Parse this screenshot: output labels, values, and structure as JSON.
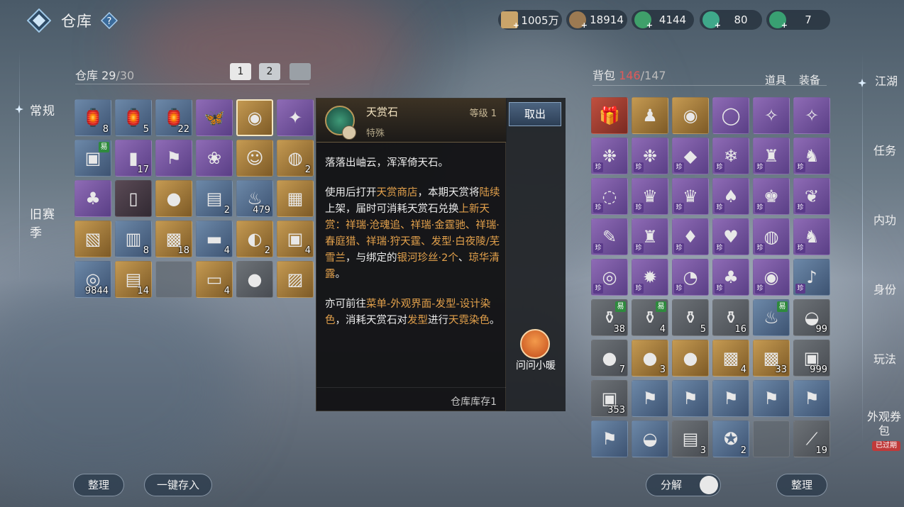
{
  "header": {
    "title": "仓库",
    "help_label": "?"
  },
  "currencies": [
    {
      "icon": "scroll-coin-icon",
      "value": "1005万",
      "color": "#c9a46a"
    },
    {
      "icon": "copper-coin-icon",
      "value": "18914",
      "color": "#9c7a52"
    },
    {
      "icon": "jade-coin-icon",
      "value": "4144",
      "color": "#3fa06a"
    },
    {
      "icon": "jade-orb-icon",
      "value": "80",
      "color": "#3fa88a"
    },
    {
      "icon": "jade-token-icon",
      "value": "7",
      "color": "#39a072"
    }
  ],
  "left_nav": {
    "items": [
      {
        "label": "常规",
        "active": true
      },
      {
        "label": "旧赛季",
        "active": false
      }
    ]
  },
  "warehouse": {
    "label": "仓库",
    "count": "29",
    "capacity": "/30",
    "tabs": [
      "1",
      "2",
      ""
    ],
    "items": [
      {
        "q": "blue",
        "g": "🏮",
        "c": "8"
      },
      {
        "q": "blue",
        "g": "🏮",
        "c": "5"
      },
      {
        "q": "blue",
        "g": "🏮",
        "c": "22"
      },
      {
        "q": "purple",
        "g": "🦋",
        "c": ""
      },
      {
        "q": "gold",
        "g": "◉",
        "c": "",
        "sel": true
      },
      {
        "q": "purple",
        "g": "✦",
        "c": ""
      },
      {
        "q": "blue",
        "g": "▣",
        "c": "",
        "trade": "易"
      },
      {
        "q": "purple",
        "g": "▮",
        "c": "17"
      },
      {
        "q": "purple",
        "g": "⚑",
        "c": ""
      },
      {
        "q": "purple",
        "g": "❀",
        "c": ""
      },
      {
        "q": "gold",
        "g": "☺",
        "c": ""
      },
      {
        "q": "gold",
        "g": "◍",
        "c": "2"
      },
      {
        "q": "purple",
        "g": "♣",
        "c": ""
      },
      {
        "q": "dark",
        "g": "▯",
        "c": ""
      },
      {
        "q": "gold",
        "g": "●",
        "c": ""
      },
      {
        "q": "blue",
        "g": "▤",
        "c": "2"
      },
      {
        "q": "blue",
        "g": "♨",
        "c": "479"
      },
      {
        "q": "gold",
        "g": "▦",
        "c": ""
      },
      {
        "q": "gold",
        "g": "▧",
        "c": ""
      },
      {
        "q": "blue",
        "g": "▥",
        "c": "8"
      },
      {
        "q": "gold",
        "g": "▩",
        "c": "18"
      },
      {
        "q": "blue",
        "g": "▬",
        "c": "4"
      },
      {
        "q": "gold",
        "g": "◐",
        "c": "2"
      },
      {
        "q": "gold",
        "g": "▣",
        "c": "4"
      },
      {
        "q": "blue",
        "g": "◎",
        "c": "9844"
      },
      {
        "q": "gold",
        "g": "▤",
        "c": "14"
      },
      {
        "q": "empty",
        "g": "",
        "c": ""
      },
      {
        "q": "gold",
        "g": "▭",
        "c": "4"
      },
      {
        "q": "gray",
        "g": "●",
        "c": ""
      },
      {
        "q": "gold",
        "g": "▨",
        "c": ""
      }
    ]
  },
  "tooltip": {
    "name": "天赏石",
    "level": "等级 1",
    "type": "特殊",
    "para1": "落落出岫云，浑浑倚天石。",
    "p2": [
      {
        "t": "使用后打开"
      },
      {
        "t": "天赏商店",
        "h": true
      },
      {
        "t": "，本期天赏将"
      },
      {
        "t": "陆续",
        "h": true
      },
      {
        "t": "上架，届时可消耗天赏石兑换"
      },
      {
        "t": "上新天赏：祥瑞·沧魂追、祥瑞·金霆驰、祥瑞·春庭猎、祥瑞·狩天霆、发型·白夜陵/芜雪兰",
        "h": true
      },
      {
        "t": "，与绑定的"
      },
      {
        "t": "银河珍丝·2个",
        "h": true
      },
      {
        "t": "、"
      },
      {
        "t": "琼华清露",
        "h": true
      },
      {
        "t": "。"
      }
    ],
    "p3": [
      {
        "t": "亦可前往"
      },
      {
        "t": "菜单-外观界面-发型-设计染色",
        "h": true
      },
      {
        "t": "，消耗天赏石对"
      },
      {
        "t": "发型",
        "h": true
      },
      {
        "t": "进行"
      },
      {
        "t": "天霓染色",
        "h": true
      },
      {
        "t": "。"
      }
    ],
    "footer": "仓库库存1",
    "take_button": "取出",
    "pet_label": "问问小暖"
  },
  "bag": {
    "label": "背包",
    "count": "146",
    "capacity": "/147",
    "tab_items": "道具",
    "tab_equip": "装备",
    "items": [
      {
        "q": "red",
        "g": "🎁",
        "c": ""
      },
      {
        "q": "gold",
        "g": "♟",
        "c": ""
      },
      {
        "q": "gold",
        "g": "◉",
        "c": ""
      },
      {
        "q": "purple",
        "g": "◯",
        "c": ""
      },
      {
        "q": "purple",
        "g": "✧",
        "c": ""
      },
      {
        "q": "purple",
        "g": "✧",
        "c": ""
      },
      {
        "q": "purple",
        "g": "❉",
        "c": "",
        "t": "珍"
      },
      {
        "q": "purple",
        "g": "❉",
        "c": "",
        "t": "珍"
      },
      {
        "q": "purple",
        "g": "◆",
        "c": "",
        "t": "珍"
      },
      {
        "q": "purple",
        "g": "❄",
        "c": "",
        "t": "珍"
      },
      {
        "q": "purple",
        "g": "♜",
        "c": "",
        "t": "珍"
      },
      {
        "q": "purple",
        "g": "♞",
        "c": "",
        "t": "珍"
      },
      {
        "q": "purple",
        "g": "◌",
        "c": "",
        "t": "珍"
      },
      {
        "q": "purple",
        "g": "♛",
        "c": "",
        "t": "珍"
      },
      {
        "q": "purple",
        "g": "♛",
        "c": "",
        "t": "珍"
      },
      {
        "q": "purple",
        "g": "♠",
        "c": "",
        "t": "珍"
      },
      {
        "q": "purple",
        "g": "♚",
        "c": "",
        "t": "珍"
      },
      {
        "q": "purple",
        "g": "❦",
        "c": "",
        "t": "珍"
      },
      {
        "q": "purple",
        "g": "✎",
        "c": "",
        "t": "珍"
      },
      {
        "q": "purple",
        "g": "♜",
        "c": "",
        "t": "珍"
      },
      {
        "q": "purple",
        "g": "♦",
        "c": "",
        "t": "珍"
      },
      {
        "q": "purple",
        "g": "♥",
        "c": "",
        "t": "珍"
      },
      {
        "q": "purple",
        "g": "◍",
        "c": "",
        "t": "珍"
      },
      {
        "q": "purple",
        "g": "♞",
        "c": "",
        "t": "珍"
      },
      {
        "q": "purple",
        "g": "◎",
        "c": "",
        "t": "珍"
      },
      {
        "q": "purple",
        "g": "✹",
        "c": "",
        "t": "珍"
      },
      {
        "q": "purple",
        "g": "◔",
        "c": "",
        "t": "珍"
      },
      {
        "q": "purple",
        "g": "♣",
        "c": "",
        "t": "珍"
      },
      {
        "q": "purple",
        "g": "◉",
        "c": "",
        "t": "珍"
      },
      {
        "q": "blue",
        "g": "♪",
        "c": "",
        "t": "珍"
      },
      {
        "q": "gray",
        "g": "⚱",
        "c": "38",
        "trade": "易"
      },
      {
        "q": "gray",
        "g": "⚱",
        "c": "4",
        "trade": "易"
      },
      {
        "q": "gray",
        "g": "⚱",
        "c": "5"
      },
      {
        "q": "gray",
        "g": "⚱",
        "c": "16"
      },
      {
        "q": "blue",
        "g": "♨",
        "c": "",
        "trade": "易"
      },
      {
        "q": "gray",
        "g": "◒",
        "c": "99"
      },
      {
        "q": "gray",
        "g": "●",
        "c": "7"
      },
      {
        "q": "gold",
        "g": "●",
        "c": "3"
      },
      {
        "q": "gold",
        "g": "●",
        "c": ""
      },
      {
        "q": "gold",
        "g": "▩",
        "c": "4"
      },
      {
        "q": "gold",
        "g": "▩",
        "c": "33"
      },
      {
        "q": "gray",
        "g": "▣",
        "c": "999"
      },
      {
        "q": "gray",
        "g": "▣",
        "c": "353"
      },
      {
        "q": "blue",
        "g": "⚑",
        "c": ""
      },
      {
        "q": "blue",
        "g": "⚑",
        "c": ""
      },
      {
        "q": "blue",
        "g": "⚑",
        "c": ""
      },
      {
        "q": "blue",
        "g": "⚑",
        "c": ""
      },
      {
        "q": "blue",
        "g": "⚑",
        "c": ""
      },
      {
        "q": "blue",
        "g": "⚑",
        "c": ""
      },
      {
        "q": "blue",
        "g": "◒",
        "c": ""
      },
      {
        "q": "gray",
        "g": "▤",
        "c": "3"
      },
      {
        "q": "blue",
        "g": "✪",
        "c": "2"
      },
      {
        "q": "empty",
        "g": "",
        "c": ""
      },
      {
        "q": "gray",
        "g": "⟋",
        "c": "19"
      }
    ]
  },
  "right_nav": {
    "items": [
      {
        "label": "江湖",
        "active": true
      },
      {
        "label": "任务"
      },
      {
        "label": "内功"
      },
      {
        "label": "身份"
      },
      {
        "label": "玩法"
      },
      {
        "label": "外观券包"
      }
    ],
    "expired_badge": "已过期"
  },
  "bottom": {
    "sort_left": "整理",
    "deposit_all": "一键存入",
    "decompose": "分解",
    "sort_right": "整理"
  },
  "colors": {
    "highlight": "#e2a04b",
    "bag_count": "#e05a5a"
  }
}
